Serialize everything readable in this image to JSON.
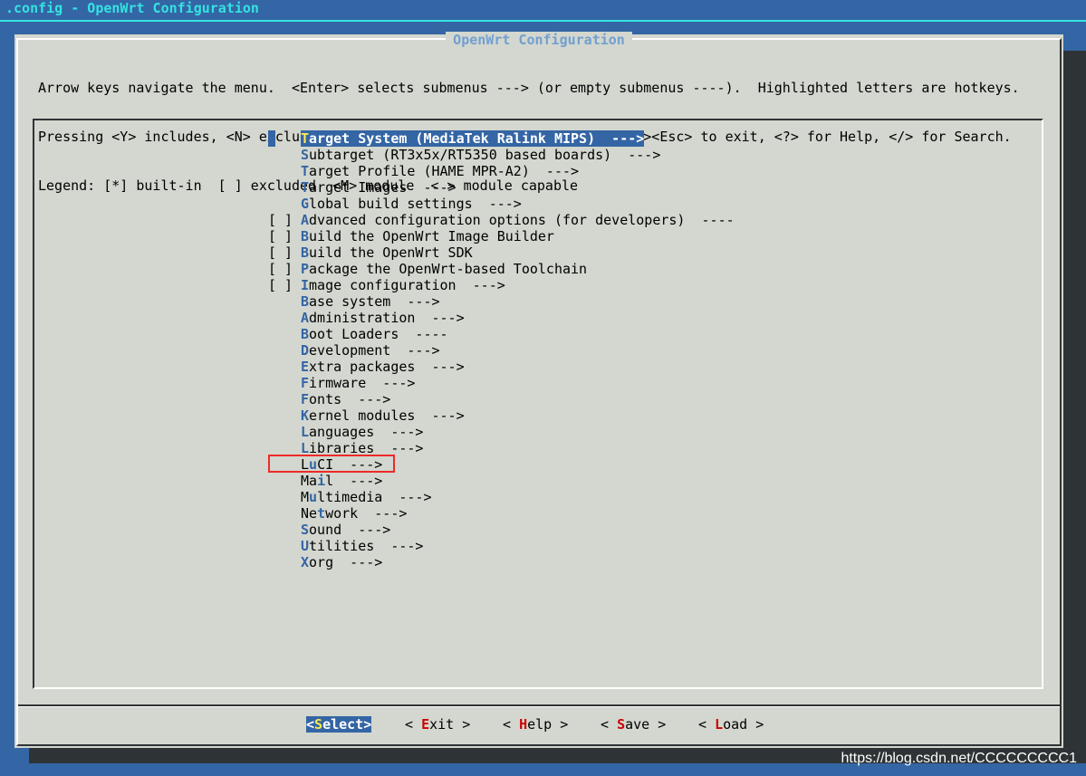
{
  "window": {
    "title": ".config - OpenWrt Configuration"
  },
  "dialog": {
    "title": "OpenWrt Configuration",
    "help_lines": [
      "Arrow keys navigate the menu.  <Enter> selects submenus ---> (or empty submenus ----).  Highlighted letters are hotkeys.",
      "Pressing <Y> includes, <N> excludes, <M> modularizes features.  Press <Esc><Esc> to exit, <?> for Help, </> for Search.",
      "Legend: [*] built-in  [ ] excluded  <M> module  < > module capable"
    ]
  },
  "menu": {
    "items": [
      {
        "box": "",
        "hot": "T",
        "rest": "arget System (MediaTek Ralink MIPS)  --->",
        "selected": true
      },
      {
        "box": "",
        "hot": "S",
        "rest": "ubtarget (RT3x5x/RT5350 based boards)  --->"
      },
      {
        "box": "",
        "hot": "T",
        "rest": "arget Profile (HAME MPR-A2)  --->"
      },
      {
        "box": "",
        "hot": "T",
        "rest": "arget Images  --->"
      },
      {
        "box": "",
        "hot": "G",
        "rest": "lobal build settings  --->"
      },
      {
        "box": "[ ]",
        "hot": "A",
        "rest": "dvanced configuration options (for developers)  ----"
      },
      {
        "box": "[ ]",
        "hot": "B",
        "rest": "uild the OpenWrt Image Builder"
      },
      {
        "box": "[ ]",
        "hot": "B",
        "rest": "uild the OpenWrt SDK"
      },
      {
        "box": "[ ]",
        "hot": "P",
        "rest": "ackage the OpenWrt-based Toolchain"
      },
      {
        "box": "[ ]",
        "hot": "I",
        "rest": "mage configuration  --->"
      },
      {
        "box": "",
        "hot": "B",
        "rest": "ase system  --->"
      },
      {
        "box": "",
        "hot": "A",
        "rest": "dministration  --->"
      },
      {
        "box": "",
        "hot": "B",
        "rest": "oot Loaders  ----"
      },
      {
        "box": "",
        "hot": "D",
        "rest": "evelopment  --->"
      },
      {
        "box": "",
        "hot": "E",
        "rest": "xtra packages  --->"
      },
      {
        "box": "",
        "hot": "F",
        "rest": "irmware  --->"
      },
      {
        "box": "",
        "hot": "F",
        "rest": "onts  --->"
      },
      {
        "box": "",
        "hot": "K",
        "rest": "ernel modules  --->"
      },
      {
        "box": "",
        "hot": "L",
        "rest": "anguages  --->"
      },
      {
        "box": "",
        "hot": "L",
        "rest": "ibraries  --->"
      },
      {
        "box": "",
        "pre": "L",
        "hot": "u",
        "rest": "CI  --->"
      },
      {
        "box": "",
        "pre": "Ma",
        "hot": "i",
        "rest": "l  --->"
      },
      {
        "box": "",
        "pre": "M",
        "hot": "u",
        "rest": "ltimedia  --->"
      },
      {
        "box": "",
        "pre": "Ne",
        "hot": "t",
        "rest": "work  --->"
      },
      {
        "box": "",
        "hot": "S",
        "rest": "ound  --->"
      },
      {
        "box": "",
        "hot": "U",
        "rest": "tilities  --->"
      },
      {
        "box": "",
        "hot": "X",
        "rest": "org  --->"
      }
    ]
  },
  "buttons": [
    {
      "pre": "<",
      "hk": "S",
      "rest": "elect>",
      "active": true
    },
    {
      "pre": "< ",
      "hk": "E",
      "rest": "xit >"
    },
    {
      "pre": "< ",
      "hk": "H",
      "rest": "elp >"
    },
    {
      "pre": "< ",
      "hk": "S",
      "rest": "ave >"
    },
    {
      "pre": "< ",
      "hk": "L",
      "rest": "oad >"
    }
  ],
  "watermark": "https://blog.csdn.net/CCCCCCCCC1",
  "colors": {
    "background": "#3465a4",
    "dialog": "#d3d7cf",
    "title": "#34e2e2",
    "hotkey": "#3465a4",
    "selected_hotkey": "#fce94f",
    "button_hotkey": "#cc0000",
    "annotation_box": "#ef2929"
  }
}
